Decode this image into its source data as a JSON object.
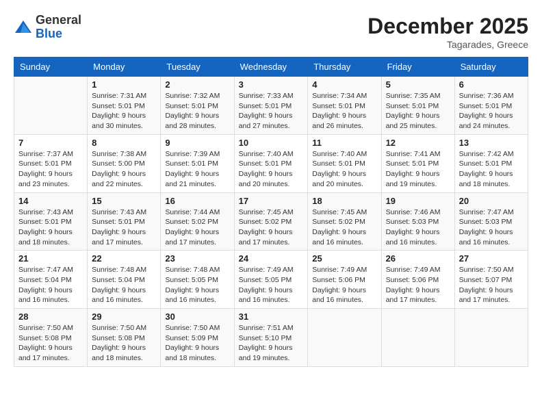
{
  "logo": {
    "general": "General",
    "blue": "Blue"
  },
  "header": {
    "month_year": "December 2025",
    "location": "Tagarades, Greece"
  },
  "weekdays": [
    "Sunday",
    "Monday",
    "Tuesday",
    "Wednesday",
    "Thursday",
    "Friday",
    "Saturday"
  ],
  "weeks": [
    [
      {
        "day": "",
        "sunrise": "",
        "sunset": "",
        "daylight": ""
      },
      {
        "day": "1",
        "sunrise": "Sunrise: 7:31 AM",
        "sunset": "Sunset: 5:01 PM",
        "daylight": "Daylight: 9 hours and 30 minutes."
      },
      {
        "day": "2",
        "sunrise": "Sunrise: 7:32 AM",
        "sunset": "Sunset: 5:01 PM",
        "daylight": "Daylight: 9 hours and 28 minutes."
      },
      {
        "day": "3",
        "sunrise": "Sunrise: 7:33 AM",
        "sunset": "Sunset: 5:01 PM",
        "daylight": "Daylight: 9 hours and 27 minutes."
      },
      {
        "day": "4",
        "sunrise": "Sunrise: 7:34 AM",
        "sunset": "Sunset: 5:01 PM",
        "daylight": "Daylight: 9 hours and 26 minutes."
      },
      {
        "day": "5",
        "sunrise": "Sunrise: 7:35 AM",
        "sunset": "Sunset: 5:01 PM",
        "daylight": "Daylight: 9 hours and 25 minutes."
      },
      {
        "day": "6",
        "sunrise": "Sunrise: 7:36 AM",
        "sunset": "Sunset: 5:01 PM",
        "daylight": "Daylight: 9 hours and 24 minutes."
      }
    ],
    [
      {
        "day": "7",
        "sunrise": "Sunrise: 7:37 AM",
        "sunset": "Sunset: 5:01 PM",
        "daylight": "Daylight: 9 hours and 23 minutes."
      },
      {
        "day": "8",
        "sunrise": "Sunrise: 7:38 AM",
        "sunset": "Sunset: 5:00 PM",
        "daylight": "Daylight: 9 hours and 22 minutes."
      },
      {
        "day": "9",
        "sunrise": "Sunrise: 7:39 AM",
        "sunset": "Sunset: 5:01 PM",
        "daylight": "Daylight: 9 hours and 21 minutes."
      },
      {
        "day": "10",
        "sunrise": "Sunrise: 7:40 AM",
        "sunset": "Sunset: 5:01 PM",
        "daylight": "Daylight: 9 hours and 20 minutes."
      },
      {
        "day": "11",
        "sunrise": "Sunrise: 7:40 AM",
        "sunset": "Sunset: 5:01 PM",
        "daylight": "Daylight: 9 hours and 20 minutes."
      },
      {
        "day": "12",
        "sunrise": "Sunrise: 7:41 AM",
        "sunset": "Sunset: 5:01 PM",
        "daylight": "Daylight: 9 hours and 19 minutes."
      },
      {
        "day": "13",
        "sunrise": "Sunrise: 7:42 AM",
        "sunset": "Sunset: 5:01 PM",
        "daylight": "Daylight: 9 hours and 18 minutes."
      }
    ],
    [
      {
        "day": "14",
        "sunrise": "Sunrise: 7:43 AM",
        "sunset": "Sunset: 5:01 PM",
        "daylight": "Daylight: 9 hours and 18 minutes."
      },
      {
        "day": "15",
        "sunrise": "Sunrise: 7:43 AM",
        "sunset": "Sunset: 5:01 PM",
        "daylight": "Daylight: 9 hours and 17 minutes."
      },
      {
        "day": "16",
        "sunrise": "Sunrise: 7:44 AM",
        "sunset": "Sunset: 5:02 PM",
        "daylight": "Daylight: 9 hours and 17 minutes."
      },
      {
        "day": "17",
        "sunrise": "Sunrise: 7:45 AM",
        "sunset": "Sunset: 5:02 PM",
        "daylight": "Daylight: 9 hours and 17 minutes."
      },
      {
        "day": "18",
        "sunrise": "Sunrise: 7:45 AM",
        "sunset": "Sunset: 5:02 PM",
        "daylight": "Daylight: 9 hours and 16 minutes."
      },
      {
        "day": "19",
        "sunrise": "Sunrise: 7:46 AM",
        "sunset": "Sunset: 5:03 PM",
        "daylight": "Daylight: 9 hours and 16 minutes."
      },
      {
        "day": "20",
        "sunrise": "Sunrise: 7:47 AM",
        "sunset": "Sunset: 5:03 PM",
        "daylight": "Daylight: 9 hours and 16 minutes."
      }
    ],
    [
      {
        "day": "21",
        "sunrise": "Sunrise: 7:47 AM",
        "sunset": "Sunset: 5:04 PM",
        "daylight": "Daylight: 9 hours and 16 minutes."
      },
      {
        "day": "22",
        "sunrise": "Sunrise: 7:48 AM",
        "sunset": "Sunset: 5:04 PM",
        "daylight": "Daylight: 9 hours and 16 minutes."
      },
      {
        "day": "23",
        "sunrise": "Sunrise: 7:48 AM",
        "sunset": "Sunset: 5:05 PM",
        "daylight": "Daylight: 9 hours and 16 minutes."
      },
      {
        "day": "24",
        "sunrise": "Sunrise: 7:49 AM",
        "sunset": "Sunset: 5:05 PM",
        "daylight": "Daylight: 9 hours and 16 minutes."
      },
      {
        "day": "25",
        "sunrise": "Sunrise: 7:49 AM",
        "sunset": "Sunset: 5:06 PM",
        "daylight": "Daylight: 9 hours and 16 minutes."
      },
      {
        "day": "26",
        "sunrise": "Sunrise: 7:49 AM",
        "sunset": "Sunset: 5:06 PM",
        "daylight": "Daylight: 9 hours and 17 minutes."
      },
      {
        "day": "27",
        "sunrise": "Sunrise: 7:50 AM",
        "sunset": "Sunset: 5:07 PM",
        "daylight": "Daylight: 9 hours and 17 minutes."
      }
    ],
    [
      {
        "day": "28",
        "sunrise": "Sunrise: 7:50 AM",
        "sunset": "Sunset: 5:08 PM",
        "daylight": "Daylight: 9 hours and 17 minutes."
      },
      {
        "day": "29",
        "sunrise": "Sunrise: 7:50 AM",
        "sunset": "Sunset: 5:08 PM",
        "daylight": "Daylight: 9 hours and 18 minutes."
      },
      {
        "day": "30",
        "sunrise": "Sunrise: 7:50 AM",
        "sunset": "Sunset: 5:09 PM",
        "daylight": "Daylight: 9 hours and 18 minutes."
      },
      {
        "day": "31",
        "sunrise": "Sunrise: 7:51 AM",
        "sunset": "Sunset: 5:10 PM",
        "daylight": "Daylight: 9 hours and 19 minutes."
      },
      {
        "day": "",
        "sunrise": "",
        "sunset": "",
        "daylight": ""
      },
      {
        "day": "",
        "sunrise": "",
        "sunset": "",
        "daylight": ""
      },
      {
        "day": "",
        "sunrise": "",
        "sunset": "",
        "daylight": ""
      }
    ]
  ]
}
